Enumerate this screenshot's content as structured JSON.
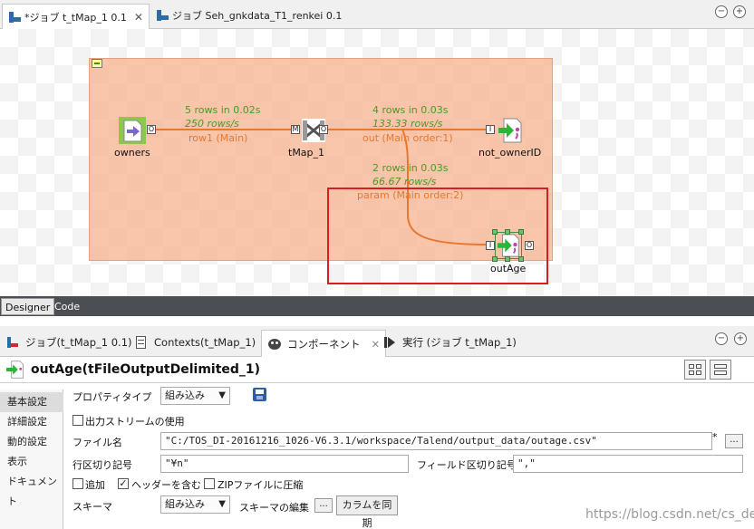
{
  "editor": {
    "tabs": [
      {
        "label": "*ジョブ t_tMap_1 0.1",
        "close": "✕"
      },
      {
        "label": "ジョブ Seh_gnkdata_T1_renkei 0.1"
      }
    ],
    "minimize": "−",
    "maximize": "+"
  },
  "canvas": {
    "components": [
      {
        "name": "owners"
      },
      {
        "name": "tMap_1"
      },
      {
        "name": "not_ownerID"
      },
      {
        "name": "outAge"
      }
    ],
    "connections": [
      {
        "stats1": "5 rows in 0.02s",
        "stats2": "250 rows/s",
        "name": "row1 (Main)"
      },
      {
        "stats1": "4 rows in 0.03s",
        "stats2": "133.33 rows/s",
        "name": "out (Main order:1)"
      },
      {
        "stats1": "2 rows in 0.03s",
        "stats2": "66.67 rows/s",
        "name": "param (Main order:2)"
      }
    ],
    "ports": {
      "out": "O",
      "in": "I",
      "main": "M"
    },
    "colors": {
      "link": "#e8782e",
      "stats": "#4b9b20",
      "highlight": "#d42020",
      "subjob": "#f6b08c"
    }
  },
  "view_tabs": [
    "Designer",
    "Code"
  ],
  "panel": {
    "tabs": [
      {
        "label": "ジョブ(t_tMap_1 0.1)",
        "icon": "job-icon"
      },
      {
        "label": "Contexts(t_tMap_1)",
        "icon": "contexts-icon"
      },
      {
        "label": "コンポーネント",
        "icon": "palette-icon",
        "close": "✕"
      },
      {
        "label": "実行 (ジョブ t_tMap_1)",
        "icon": "run-icon"
      }
    ],
    "minimize": "−",
    "maximize": "+"
  },
  "component": {
    "title": "outAge(tFileOutputDelimited_1)",
    "side_tabs": [
      "基本設定",
      "詳細設定",
      "動的設定",
      "表示",
      "ドキュメント"
    ],
    "property_type_label": "プロパティタイプ",
    "property_type_value": "組み込み",
    "use_output_stream_label": "出力ストリームの使用",
    "file_name_label": "ファイル名",
    "file_name_value": "\"C:/TOS_DI-20161216_1026-V6.3.1/workspace/Talend/output_data/outage.csv\"",
    "required_mark": "*",
    "dots": "...",
    "row_separator_label": "行区切り記号",
    "row_separator_value": "\"¥n\"",
    "field_separator_label": "フィールド区切り記号",
    "field_separator_value": "\",\"",
    "append_label": "追加",
    "include_header_label": "ヘッダーを含む",
    "zip_label": "ZIPファイルに圧縮",
    "include_header_checked": "✓",
    "schema_label": "スキーマ",
    "schema_value": "組み込み",
    "edit_schema_label": "スキーマの編集",
    "sync_columns_label": "カラムを同期"
  },
  "watermark": "https://blog.csdn.net/cs_de_bug"
}
